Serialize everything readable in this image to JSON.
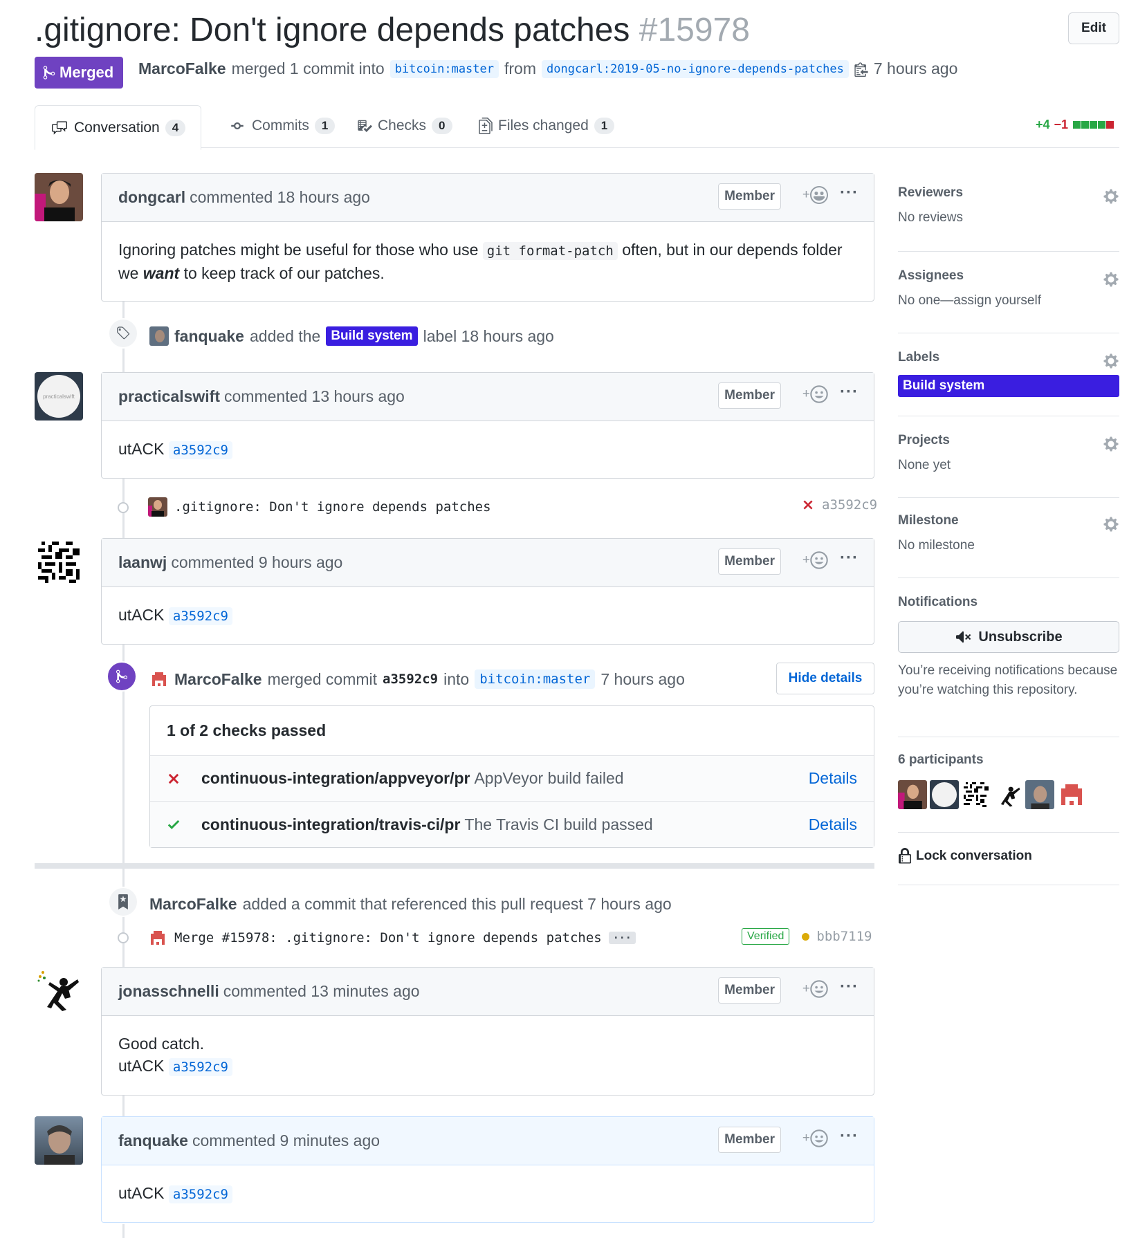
{
  "header": {
    "title": ".gitignore: Don't ignore depends patches",
    "number": "#15978",
    "edit_label": "Edit",
    "state": "Merged",
    "author": "MarcoFalke",
    "action_text": "merged 1 commit into",
    "base_branch": "bitcoin:master",
    "from_text": "from",
    "head_branch": "dongcarl:2019-05-no-ignore-depends-patches",
    "time": "7 hours ago"
  },
  "tabs": [
    {
      "label": "Conversation",
      "count": "4",
      "icon": "comment-discussion-icon"
    },
    {
      "label": "Commits",
      "count": "1",
      "icon": "git-commit-icon"
    },
    {
      "label": "Checks",
      "count": "0",
      "icon": "checklist-icon"
    },
    {
      "label": "Files changed",
      "count": "1",
      "icon": "file-diff-icon"
    }
  ],
  "diffstat": {
    "additions": "+4",
    "deletions": "−1",
    "colors": [
      "#28a745",
      "#28a745",
      "#28a745",
      "#28a745",
      "#cb2431"
    ]
  },
  "timeline": {
    "c1": {
      "author": "dongcarl",
      "meta": "commented 18 hours ago",
      "role": "Member",
      "body_pre": "Ignoring patches might be useful for those who use",
      "body_code": "git format-patch",
      "body_mid": "often, but in our depends folder we",
      "body_em": "want",
      "body_post": "to keep track of our patches."
    },
    "label_event": {
      "actor": "fanquake",
      "pre": "added the",
      "label": "Build system",
      "post": "label 18 hours ago"
    },
    "c2": {
      "author": "practicalswift",
      "meta": "commented 13 hours ago",
      "role": "Member",
      "body": "utACK",
      "sha": "a3592c9",
      "avatar_text": "practicalswift"
    },
    "commit1": {
      "message": ".gitignore: Don't ignore depends patches",
      "sha": "a3592c9"
    },
    "c3": {
      "author": "laanwj",
      "meta": "commented 9 hours ago",
      "role": "Member",
      "body": "utACK",
      "sha": "a3592c9"
    },
    "merge_event": {
      "actor": "MarcoFalke",
      "pre": "merged commit",
      "sha": "a3592c9",
      "into": "into",
      "branch": "bitcoin:master",
      "time": "7 hours ago",
      "hide_label": "Hide details"
    },
    "checks": {
      "summary": "1 of 2 checks passed",
      "rows": [
        {
          "status": "fail",
          "name": "continuous-integration/appveyor/pr",
          "desc": "AppVeyor build failed",
          "link": "Details"
        },
        {
          "status": "pass",
          "name": "continuous-integration/travis-ci/pr",
          "desc": "The Travis CI build passed",
          "link": "Details"
        }
      ]
    },
    "ref_event": {
      "actor": "MarcoFalke",
      "text": "added a commit that referenced this pull request 7 hours ago"
    },
    "commit2": {
      "message": "Merge #15978: .gitignore: Don't ignore depends patches",
      "verified": "Verified",
      "sha": "bbb7119",
      "ellipsis": "···"
    },
    "c4": {
      "author": "jonasschnelli",
      "meta": "commented 13 minutes ago",
      "role": "Member",
      "line1": "Good catch.",
      "body": "utACK",
      "sha": "a3592c9"
    },
    "c5": {
      "author": "fanquake",
      "meta": "commented 9 minutes ago",
      "role": "Member",
      "body": "utACK",
      "sha": "a3592c9"
    },
    "more_label": "···",
    "react_plus": "+"
  },
  "sidebar": {
    "reviewers": {
      "title": "Reviewers",
      "value": "No reviews"
    },
    "assignees": {
      "title": "Assignees",
      "value": "No one—assign yourself"
    },
    "labels": {
      "title": "Labels",
      "value": "Build system"
    },
    "projects": {
      "title": "Projects",
      "value": "None yet"
    },
    "milestone": {
      "title": "Milestone",
      "value": "No milestone"
    },
    "notifications": {
      "title": "Notifications",
      "button": "Unsubscribe",
      "text": "You’re receiving notifications because you’re watching this repository."
    },
    "participants": {
      "title": "6 participants"
    },
    "lock": {
      "label": "Lock conversation"
    }
  }
}
